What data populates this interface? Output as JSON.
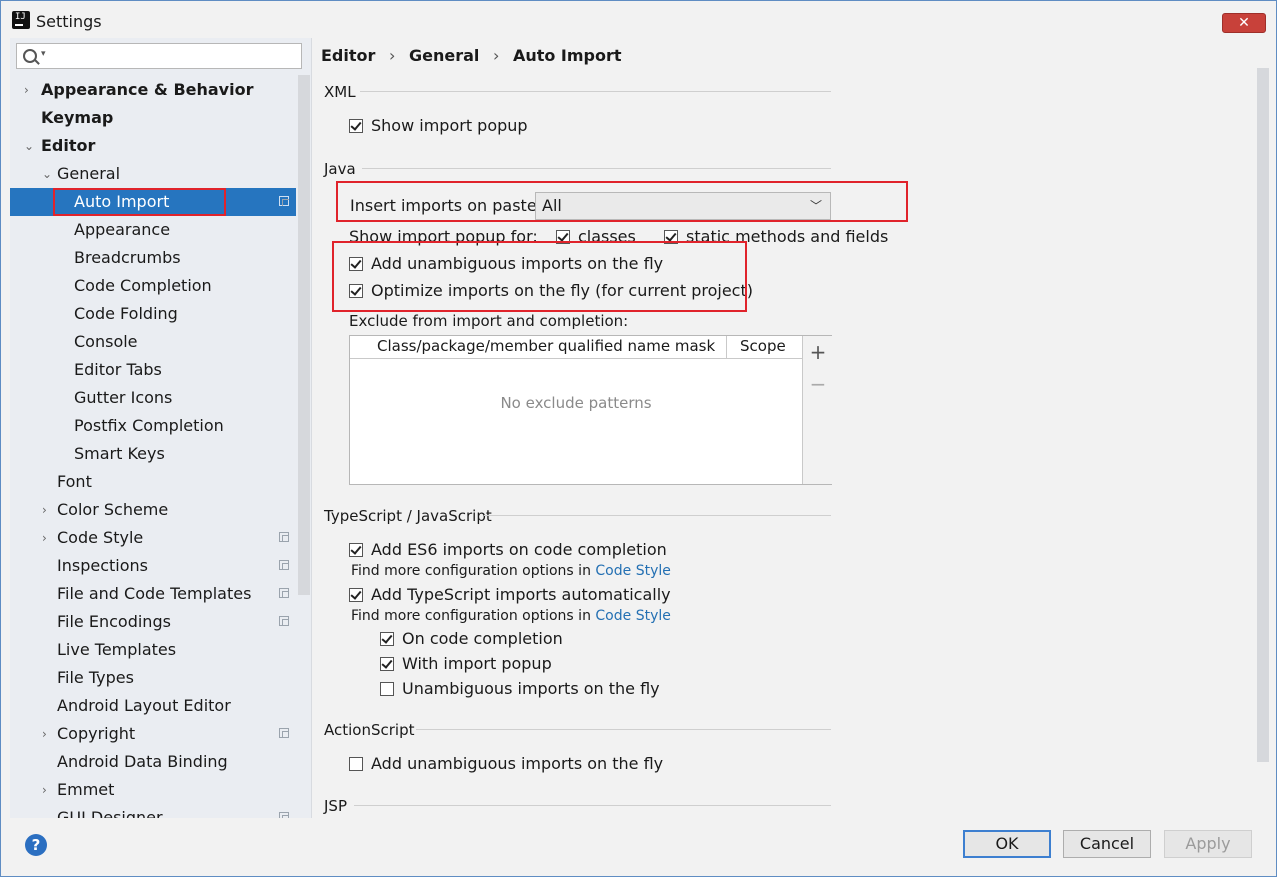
{
  "window": {
    "title": "Settings",
    "close_label": "✕"
  },
  "search": {
    "placeholder": ""
  },
  "sidebar": {
    "items": [
      {
        "label": "Appearance & Behavior",
        "level": 0,
        "arrow": "›",
        "bold": true
      },
      {
        "label": "Keymap",
        "level": 0,
        "arrow": "",
        "bold": true
      },
      {
        "label": "Editor",
        "level": 0,
        "arrow": "⌄",
        "bold": true
      },
      {
        "label": "General",
        "level": 1,
        "arrow": "⌄"
      },
      {
        "label": "Auto Import",
        "level": 2,
        "selected": true,
        "project_icon": true
      },
      {
        "label": "Appearance",
        "level": 2
      },
      {
        "label": "Breadcrumbs",
        "level": 2
      },
      {
        "label": "Code Completion",
        "level": 2
      },
      {
        "label": "Code Folding",
        "level": 2
      },
      {
        "label": "Console",
        "level": 2
      },
      {
        "label": "Editor Tabs",
        "level": 2
      },
      {
        "label": "Gutter Icons",
        "level": 2
      },
      {
        "label": "Postfix Completion",
        "level": 2
      },
      {
        "label": "Smart Keys",
        "level": 2
      },
      {
        "label": "Font",
        "level": 1
      },
      {
        "label": "Color Scheme",
        "level": 1,
        "arrow": "›"
      },
      {
        "label": "Code Style",
        "level": 1,
        "arrow": "›",
        "project_icon": true
      },
      {
        "label": "Inspections",
        "level": 1,
        "project_icon": true
      },
      {
        "label": "File and Code Templates",
        "level": 1,
        "project_icon": true
      },
      {
        "label": "File Encodings",
        "level": 1,
        "project_icon": true
      },
      {
        "label": "Live Templates",
        "level": 1
      },
      {
        "label": "File Types",
        "level": 1
      },
      {
        "label": "Android Layout Editor",
        "level": 1
      },
      {
        "label": "Copyright",
        "level": 1,
        "arrow": "›",
        "project_icon": true
      },
      {
        "label": "Android Data Binding",
        "level": 1
      },
      {
        "label": "Emmet",
        "level": 1,
        "arrow": "›"
      },
      {
        "label": "GUI Designer",
        "level": 1,
        "project_icon": true
      }
    ]
  },
  "breadcrumb": {
    "items": [
      "Editor",
      "General",
      "Auto Import"
    ],
    "separator": "›"
  },
  "xml": {
    "title": "XML",
    "show_import_popup": {
      "label": "Show import popup",
      "checked": true
    }
  },
  "java": {
    "title": "Java",
    "insert_imports_label": "Insert imports on paste:",
    "insert_imports_value": "All",
    "show_popup_for_label": "Show import popup for:",
    "classes": {
      "label": "classes",
      "checked": true
    },
    "static_methods": {
      "label": "static methods and fields",
      "checked": true
    },
    "add_unambiguous": {
      "label": "Add unambiguous imports on the fly",
      "checked": true
    },
    "optimize_imports": {
      "label": "Optimize imports on the fly (for current project)",
      "checked": true
    },
    "exclude_label": "Exclude from import and completion:",
    "exclude_table": {
      "columns": [
        "Class/package/member qualified name mask",
        "Scope"
      ],
      "empty_text": "No exclude patterns",
      "add_icon": "+",
      "remove_icon": "−"
    }
  },
  "typescript": {
    "title": "TypeScript / JavaScript",
    "es6": {
      "label": "Add ES6 imports on code completion",
      "checked": true
    },
    "find_more_1": "Find more configuration options in",
    "code_style_link_1": "Code Style",
    "ts_auto": {
      "label": "Add TypeScript imports automatically",
      "checked": true
    },
    "find_more_2": "Find more configuration options in",
    "code_style_link_2": "Code Style",
    "on_code_completion": {
      "label": "On code completion",
      "checked": true
    },
    "with_import_popup": {
      "label": "With import popup",
      "checked": true
    },
    "unambiguous_fly": {
      "label": "Unambiguous imports on the fly",
      "checked": false
    }
  },
  "actionscript": {
    "title": "ActionScript",
    "add_unambiguous": {
      "label": "Add unambiguous imports on the fly",
      "checked": false
    }
  },
  "jsp": {
    "title": "JSP"
  },
  "buttons": {
    "ok": "OK",
    "cancel": "Cancel",
    "apply": "Apply",
    "help": "?"
  },
  "colors": {
    "selection": "#2675bf",
    "annotation_red": "#e0232b",
    "link": "#2470b3"
  }
}
